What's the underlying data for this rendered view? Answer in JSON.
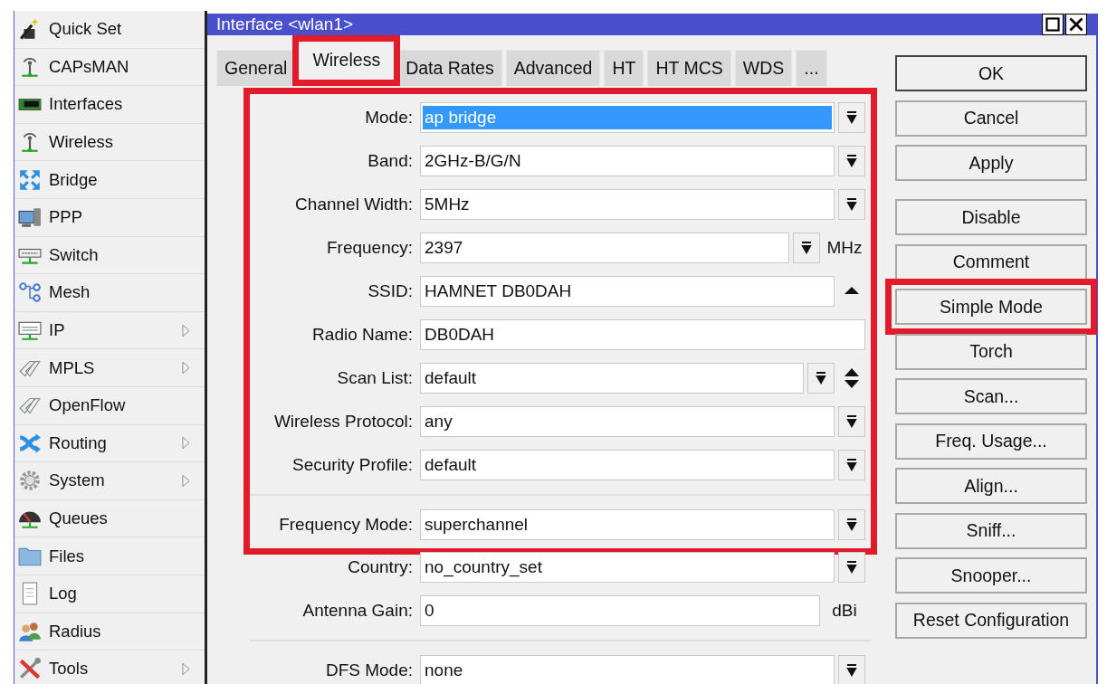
{
  "sidebar": {
    "items": [
      {
        "label": "Quick Set",
        "has_submenu": false
      },
      {
        "label": "CAPsMAN",
        "has_submenu": false
      },
      {
        "label": "Interfaces",
        "has_submenu": false
      },
      {
        "label": "Wireless",
        "has_submenu": false
      },
      {
        "label": "Bridge",
        "has_submenu": false
      },
      {
        "label": "PPP",
        "has_submenu": false
      },
      {
        "label": "Switch",
        "has_submenu": false
      },
      {
        "label": "Mesh",
        "has_submenu": false
      },
      {
        "label": "IP",
        "has_submenu": true
      },
      {
        "label": "MPLS",
        "has_submenu": true
      },
      {
        "label": "OpenFlow",
        "has_submenu": false
      },
      {
        "label": "Routing",
        "has_submenu": true
      },
      {
        "label": "System",
        "has_submenu": true
      },
      {
        "label": "Queues",
        "has_submenu": false
      },
      {
        "label": "Files",
        "has_submenu": false
      },
      {
        "label": "Log",
        "has_submenu": false
      },
      {
        "label": "Radius",
        "has_submenu": false
      },
      {
        "label": "Tools",
        "has_submenu": true
      }
    ]
  },
  "window": {
    "title": "Interface <wlan1>",
    "tabs": [
      {
        "label": "General",
        "selected": false,
        "highlighted": false
      },
      {
        "label": "Wireless",
        "selected": true,
        "highlighted": true
      },
      {
        "label": "Data Rates",
        "selected": false,
        "highlighted": false
      },
      {
        "label": "Advanced",
        "selected": false,
        "highlighted": false
      },
      {
        "label": "HT",
        "selected": false,
        "highlighted": false
      },
      {
        "label": "HT MCS",
        "selected": false,
        "highlighted": false
      },
      {
        "label": "WDS",
        "selected": false,
        "highlighted": false
      },
      {
        "label": "...",
        "selected": false,
        "highlighted": false
      }
    ],
    "sections": [
      {
        "highlighted": true,
        "groups": [
          {
            "fields": [
              {
                "label": "Mode:",
                "value": "ap bridge",
                "kind": "dropdown",
                "selected": true
              },
              {
                "label": "Band:",
                "value": "2GHz-B/G/N",
                "kind": "dropdown",
                "selected": false
              },
              {
                "label": "Channel Width:",
                "value": "5MHz",
                "kind": "dropdown",
                "selected": false
              },
              {
                "label": "Frequency:",
                "value": "2397",
                "kind": "unit-dropdown",
                "unit": "MHz",
                "selected": false
              },
              {
                "label": "SSID:",
                "value": "HAMNET DB0DAH",
                "kind": "collapse",
                "selected": false
              },
              {
                "label": "Radio Name:",
                "value": "DB0DAH",
                "kind": "text",
                "selected": false
              },
              {
                "label": "Scan List:",
                "value": "default",
                "kind": "list",
                "selected": false
              },
              {
                "label": "Wireless Protocol:",
                "value": "any",
                "kind": "dropdown",
                "selected": false
              },
              {
                "label": "Security Profile:",
                "value": "default",
                "kind": "dropdown",
                "selected": false
              }
            ]
          },
          {
            "fields": [
              {
                "label": "Frequency Mode:",
                "value": "superchannel",
                "kind": "dropdown",
                "selected": false
              }
            ]
          }
        ]
      },
      {
        "highlighted": false,
        "groups": [
          {
            "fields": [
              {
                "label": "Country:",
                "value": "no_country_set",
                "kind": "dropdown",
                "selected": false
              },
              {
                "label": "Antenna Gain:",
                "value": "0",
                "kind": "unit",
                "unit": "dBi",
                "selected": false
              }
            ]
          },
          {
            "fields": [
              {
                "label": "DFS Mode:",
                "value": "none",
                "kind": "dropdown",
                "selected": false
              }
            ]
          }
        ]
      }
    ],
    "button_groups": [
      {
        "buttons": [
          {
            "label": "OK",
            "highlighted": false
          },
          {
            "label": "Cancel",
            "highlighted": false
          },
          {
            "label": "Apply",
            "highlighted": false
          }
        ]
      },
      {
        "buttons": [
          {
            "label": "Disable",
            "highlighted": false
          },
          {
            "label": "Comment",
            "highlighted": false
          },
          {
            "label": "Simple Mode",
            "highlighted": true
          },
          {
            "label": "Torch",
            "highlighted": false
          },
          {
            "label": "Scan...",
            "highlighted": false
          },
          {
            "label": "Freq. Usage...",
            "highlighted": false
          },
          {
            "label": "Align...",
            "highlighted": false
          },
          {
            "label": "Sniff...",
            "highlighted": false
          },
          {
            "label": "Snooper...",
            "highlighted": false
          },
          {
            "label": "Reset Configuration",
            "highlighted": false
          }
        ]
      }
    ]
  }
}
